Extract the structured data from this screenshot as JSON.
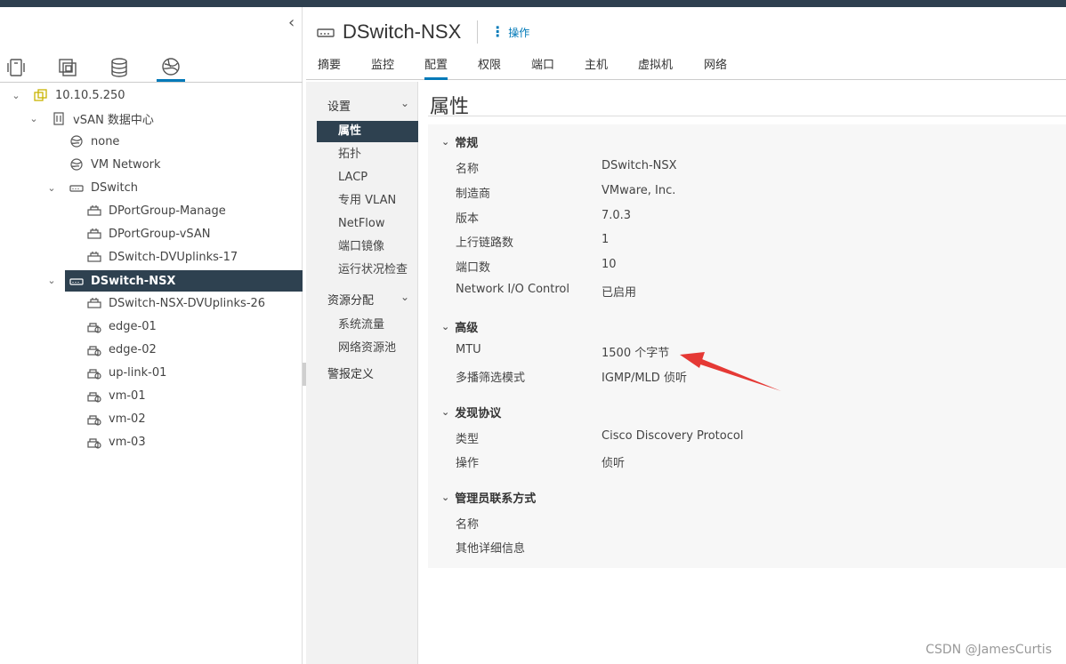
{
  "colors": {
    "accent": "#0079b8",
    "selected_bg": "#2e4150",
    "topbar": "#2e3f4f",
    "annotation": "#e53935"
  },
  "left_nav": {
    "collapse_icon": "chevron-left-icon",
    "tabs": [
      {
        "icon": "hosts-clusters-icon"
      },
      {
        "icon": "vms-templates-icon"
      },
      {
        "icon": "storage-icon"
      },
      {
        "icon": "networking-icon"
      }
    ],
    "tree": [
      {
        "label": "10.10.5.250",
        "icon": "vcenter-icon"
      },
      {
        "label": "vSAN 数据中心",
        "icon": "datacenter-icon"
      },
      {
        "label": "none",
        "icon": "network-icon"
      },
      {
        "label": "VM Network",
        "icon": "network-icon"
      },
      {
        "label": "DSwitch",
        "icon": "dvswitch-icon"
      },
      {
        "label": "DPortGroup-Manage",
        "icon": "portgroup-icon"
      },
      {
        "label": "DPortGroup-vSAN",
        "icon": "portgroup-icon"
      },
      {
        "label": "DSwitch-DVUplinks-17",
        "icon": "portgroup-icon"
      },
      {
        "label": "DSwitch-NSX",
        "icon": "dvswitch-icon"
      },
      {
        "label": "DSwitch-NSX-DVUplinks-26",
        "icon": "portgroup-icon"
      },
      {
        "label": "edge-01",
        "icon": "nsx-segment-icon"
      },
      {
        "label": "edge-02",
        "icon": "nsx-segment-icon"
      },
      {
        "label": "up-link-01",
        "icon": "nsx-segment-icon"
      },
      {
        "label": "vm-01",
        "icon": "nsx-segment-icon"
      },
      {
        "label": "vm-02",
        "icon": "nsx-segment-icon"
      },
      {
        "label": "vm-03",
        "icon": "nsx-segment-icon"
      }
    ]
  },
  "header": {
    "title": "DSwitch-NSX",
    "icon": "dvswitch-icon",
    "actions_label": "操作"
  },
  "main_tabs": [
    "摘要",
    "监控",
    "配置",
    "权限",
    "端口",
    "主机",
    "虚拟机",
    "网络"
  ],
  "active_tab": "配置",
  "settings_nav": {
    "group1": "设置",
    "group1_items": [
      "属性",
      "拓扑",
      "LACP",
      "专用 VLAN",
      "NetFlow",
      "端口镜像",
      "运行状况检查"
    ],
    "group2": "资源分配",
    "group2_items": [
      "系统流量",
      "网络资源池"
    ],
    "alarm": "警报定义"
  },
  "properties": {
    "title": "属性",
    "sections": [
      {
        "name": "常规",
        "rows": [
          {
            "label": "名称",
            "value": "DSwitch-NSX"
          },
          {
            "label": "制造商",
            "value": "VMware, Inc."
          },
          {
            "label": "版本",
            "value": "7.0.3"
          },
          {
            "label": "上行链路数",
            "value": "1"
          },
          {
            "label": "端口数",
            "value": "10"
          },
          {
            "label": "Network I/O Control",
            "value": "已启用"
          }
        ]
      },
      {
        "name": "高级",
        "rows": [
          {
            "label": "MTU",
            "value": "1500 个字节"
          },
          {
            "label": "多播筛选模式",
            "value": "IGMP/MLD 侦听"
          }
        ]
      },
      {
        "name": "发现协议",
        "rows": [
          {
            "label": "类型",
            "value": "Cisco Discovery Protocol"
          },
          {
            "label": "操作",
            "value": "侦听"
          }
        ]
      },
      {
        "name": "管理员联系方式",
        "rows": [
          {
            "label": "名称",
            "value": ""
          },
          {
            "label": "其他详细信息",
            "value": ""
          }
        ]
      }
    ]
  },
  "watermark": "CSDN @JamesCurtis"
}
